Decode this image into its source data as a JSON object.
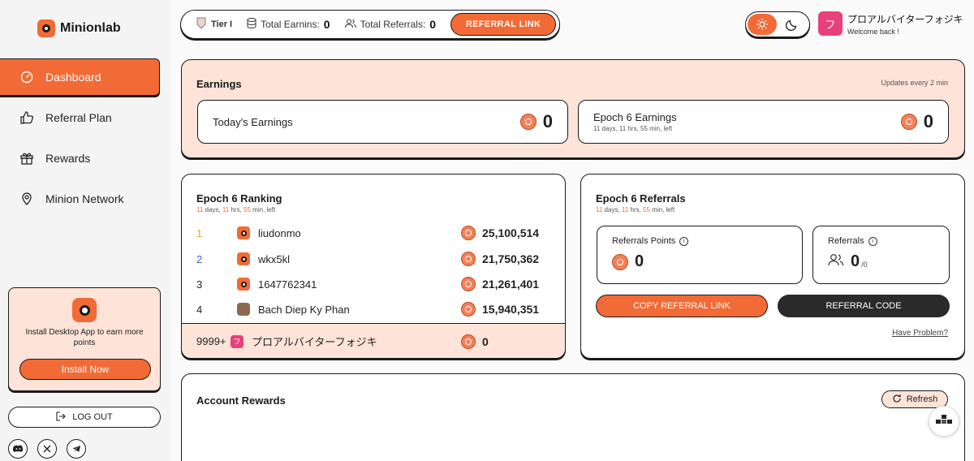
{
  "brand": {
    "name": "Minionlab"
  },
  "sidebar": {
    "items": [
      {
        "label": "Dashboard",
        "icon": "gauge-icon",
        "active": true
      },
      {
        "label": "Referral Plan",
        "icon": "thumbs-up-icon"
      },
      {
        "label": "Rewards",
        "icon": "gift-icon"
      },
      {
        "label": "Minion Network",
        "icon": "location-pin-icon"
      }
    ],
    "promo": {
      "text": "Install Desktop App to earn more points",
      "button": "Install Now"
    },
    "logout": "LOG OUT",
    "socials": [
      "discord-icon",
      "x-icon",
      "telegram-icon"
    ]
  },
  "topbar": {
    "tier": "Tier I",
    "earnings_label": "Total Earnins:",
    "earnings_value": "0",
    "referrals_label": "Total Referrals:",
    "referrals_value": "0",
    "referral_link_button": "REFERRAL LINK"
  },
  "user": {
    "avatar_letter": "フ",
    "name": "プロアルバイターフォジキ",
    "greeting": "Welcome back !"
  },
  "earnings": {
    "title": "Earnings",
    "update_note": "Updates every 2 min",
    "today": {
      "label": "Today's Earnings",
      "value": "0"
    },
    "epoch": {
      "label": "Epoch 6 Earnings",
      "value": "0"
    }
  },
  "countdown": {
    "days": "11",
    "hrs": "11",
    "mins": "55",
    "days_label": "days,",
    "hrs_label": "hrs,",
    "mins_label": "min, left"
  },
  "ranking": {
    "title": "Epoch 6 Ranking",
    "rows": [
      {
        "rank": "1",
        "name": "liudonmo",
        "score": "25,100,514",
        "rank_color": "#e8a72a",
        "avatar": "minion"
      },
      {
        "rank": "2",
        "name": "wkx5kl",
        "score": "21,750,362",
        "rank_color": "#3a5fcd",
        "avatar": "minion"
      },
      {
        "rank": "3",
        "name": "1647762341",
        "score": "21,261,401",
        "rank_color": "#222222",
        "avatar": "minion"
      },
      {
        "rank": "4",
        "name": "Bach Diep Ky Phan",
        "score": "15,940,351",
        "rank_color": "#222222",
        "avatar": "photo"
      }
    ],
    "me": {
      "rank": "9999+",
      "name": "プロアルバイターフォジキ",
      "score": "0",
      "avatar_letter": "フ"
    }
  },
  "referrals": {
    "title": "Epoch 6 Referrals",
    "points_label": "Referrals Points",
    "points_value": "0",
    "count_label": "Referrals",
    "count_value": "0",
    "count_suffix": "/0",
    "copy_button": "COPY REFERRAL LINK",
    "code_button": "REFERRAL CODE",
    "problem_link": "Have Problem?"
  },
  "account_rewards": {
    "title": "Account Rewards",
    "refresh": "Refresh"
  },
  "colors": {
    "accent": "#f26a35",
    "accent_light": "#fde3d8",
    "dark": "#1a1a1a"
  }
}
